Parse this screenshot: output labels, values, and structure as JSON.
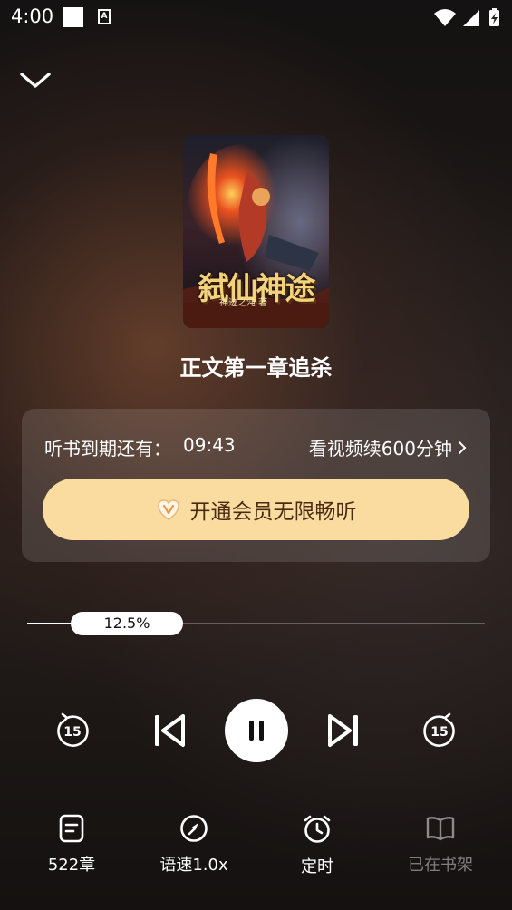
{
  "status_bar": {
    "time": "4:00",
    "notif_icon": "A"
  },
  "player": {
    "collapse_icon": "chevron-down-icon",
    "cover": {
      "title_art": "弑仙神途",
      "author_art": "神迹之沌 著"
    },
    "chapter_title": "正文第一章追杀",
    "vip_card": {
      "trial_label": "听书到期还有：",
      "trial_time": "09:43",
      "watch_link": "看视频续600分钟",
      "vip_button": "开通会员无限畅听"
    },
    "progress": {
      "percent_text": "12.5%",
      "value": 0.125
    },
    "controls": {
      "rewind_seconds": "15",
      "forward_seconds": "15"
    },
    "bottom_bar": {
      "chapters": "522章",
      "speed": "语速1.0x",
      "timer": "定时",
      "shelf": "已在书架"
    }
  },
  "colors": {
    "vip_button_bg": "#fbdca0",
    "vip_button_text": "#4a2c12"
  }
}
